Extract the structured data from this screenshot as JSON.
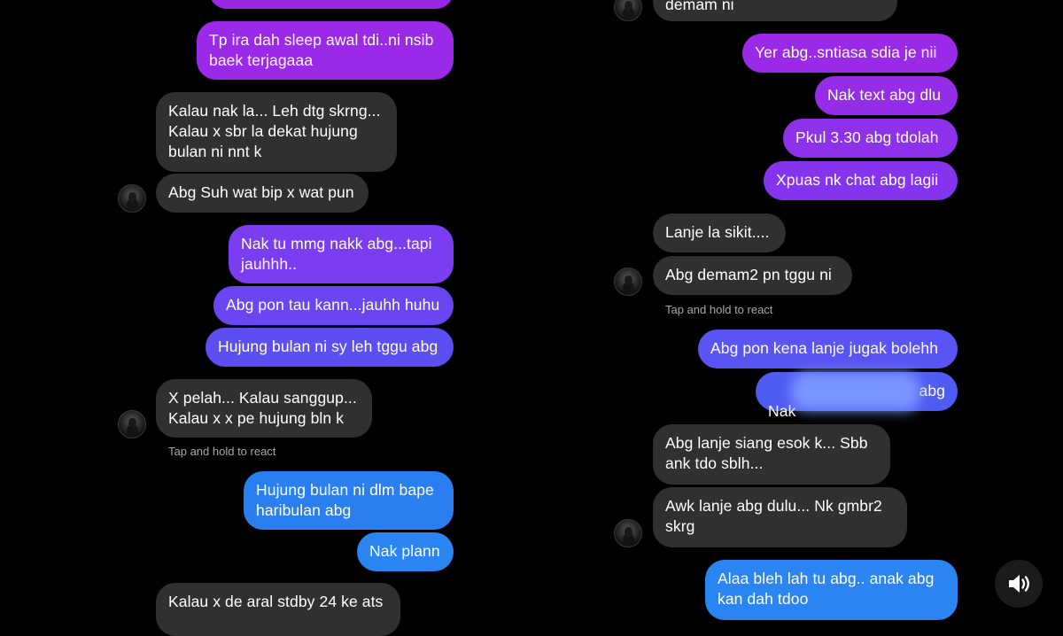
{
  "left": {
    "messages": [
      {
        "text": "",
        "dir": "out",
        "color": "#9b27e6"
      },
      {
        "text": "Tp ira dah sleep awal tdi..ni nsib\nbaek terjagaaa",
        "dir": "out",
        "color": "#9a2ae8"
      },
      {
        "text": "Kalau nak la... Leh dtg skrng...\nKalau x sbr la dekat hujung\nbulan ni nnt k",
        "dir": "in"
      },
      {
        "text": "Abg Suh wat bip x wat pun",
        "dir": "in"
      },
      {
        "text": "Nak tu mmg nakk abg...tapi\njauhhh..",
        "dir": "out",
        "color": "#7a3df0"
      },
      {
        "text": "Abg pon tau kann...jauhh huhu",
        "dir": "out",
        "color": "#6a45f2"
      },
      {
        "text": "Hujung bulan ni sy leh tggu abg",
        "dir": "out",
        "color": "#5d4ef2"
      },
      {
        "text": "X pelah... Kalau sanggup...\nKalau x x pe hujung bln k",
        "dir": "in"
      },
      {
        "text": "Hujung bulan ni dlm bape\nharibulan abg",
        "dir": "out",
        "color": "#2a7ff0"
      },
      {
        "text": "Nak plann",
        "dir": "out",
        "color": "#2a84f2"
      },
      {
        "text": "Kalau x de aral stdby 24 ke ats",
        "dir": "in"
      }
    ],
    "hint": "Tap and hold to react"
  },
  "right": {
    "messages": [
      {
        "text": "demam ni",
        "dir": "in"
      },
      {
        "text": "Yer abg..sntiasa sdia je nii",
        "dir": "out",
        "color": "#9a2ae8"
      },
      {
        "text": "Nak text abg dlu",
        "dir": "out",
        "color": "#952de8"
      },
      {
        "text": "Pkul 3.30 abg tdolah",
        "dir": "out",
        "color": "#8e31ea"
      },
      {
        "text": "Xpuas nk chat abg lagii",
        "dir": "out",
        "color": "#8434ec"
      },
      {
        "text": "Lanje la sikit....",
        "dir": "in"
      },
      {
        "text": "Abg demam2 pn tggu ni",
        "dir": "in"
      },
      {
        "text": "Abg pon kena lanje jugak bolehh",
        "dir": "out",
        "color": "#5a55f2"
      },
      {
        "text": "Nak",
        "dir": "out",
        "color": "#4f5cf2"
      },
      {
        "text": "Abg lanje siang esok k... Sbb\nank tdo sblh...",
        "dir": "in"
      },
      {
        "text": "Awk lanje abg dulu... Nk gmbr2\nskrg",
        "dir": "in"
      },
      {
        "text": "Alaa bleh lah tu abg.. anak abg\nkan dah tdoo",
        "dir": "out",
        "color": "#2a84f2"
      }
    ],
    "redacted_tail": "abg",
    "hint": "Tap and hold to react"
  },
  "icons": {
    "sound": "speaker-icon"
  }
}
